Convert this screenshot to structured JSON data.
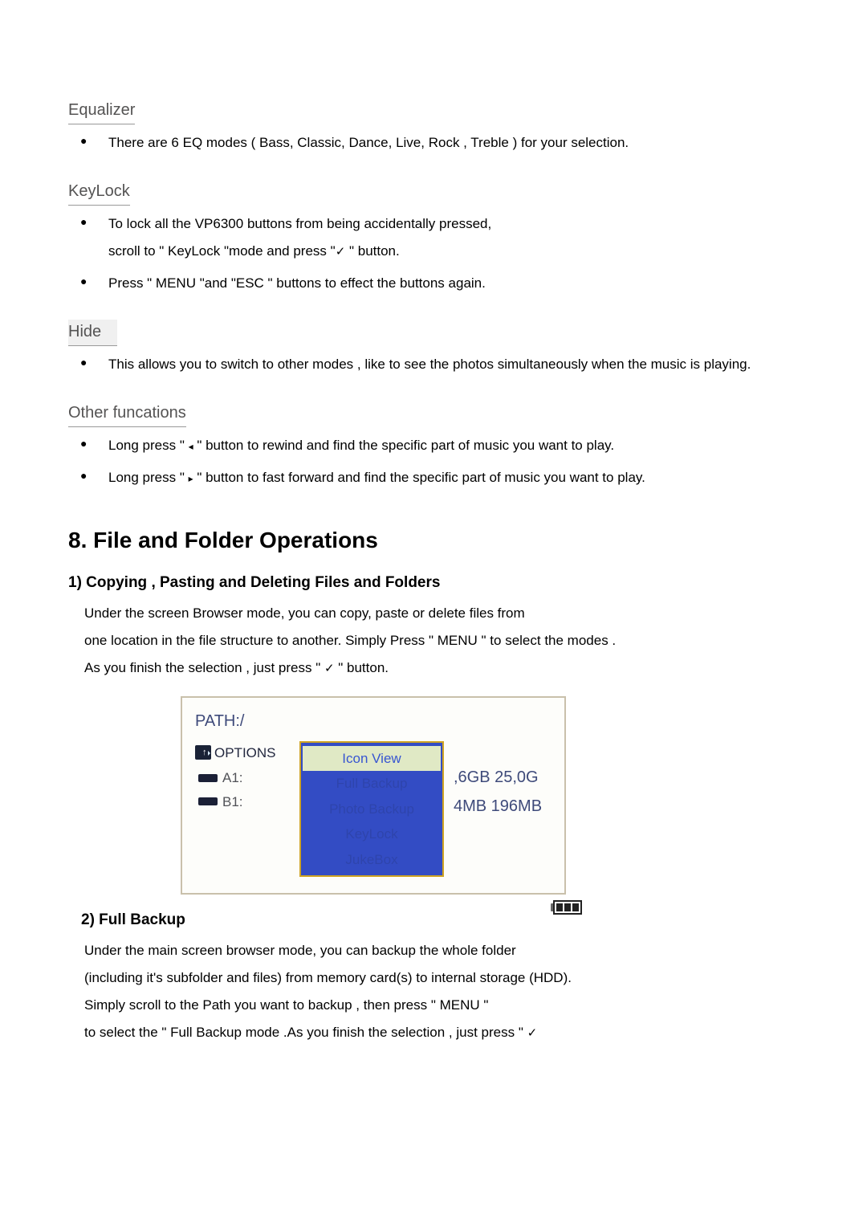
{
  "equalizer": {
    "heading": "Equalizer",
    "item1": "There are 6 EQ modes ( Bass, Classic, Dance, Live, Rock , Treble ) for your selection."
  },
  "keylock": {
    "heading": "KeyLock",
    "item1_a": "To lock all the VP6300 buttons from being accidentally pressed,",
    "item1_b": "scroll to \" KeyLock \"mode and press    \"",
    "item1_c": " \" button.",
    "item2": "Press \" MENU \"and \"ESC \" buttons to effect the buttons again."
  },
  "hide": {
    "heading": "Hide",
    "item1": "This allows you to switch to other modes , like to see the photos simultaneously when the music is playing."
  },
  "other": {
    "heading": "Other funcations",
    "item1_a": "Long press \" ",
    "item1_b": "    \" button to rewind and find the specific part of music you want to play.",
    "item2_a": "Long press \"  ",
    "item2_b": "  \" button to fast forward and find the specific part of music you want to play."
  },
  "section8": {
    "heading": "8. File and Folder Operations",
    "sub1_heading": "1) Copying , Pasting and Deleting Files and Folders",
    "sub1_p1": "Under the screen Browser mode, you can copy, paste or delete files from",
    "sub1_p2": "one location in the file structure to another. Simply Press \" MENU \" to select the modes .",
    "sub1_p3a": "As you finish the selection , just press \" ",
    "sub1_p3b": "    \" button.",
    "sub2_heading": "2) Full Backup",
    "sub2_p1": "Under the main screen browser mode, you can backup the whole folder",
    "sub2_p2": "(including it's subfolder and files) from memory card(s) to internal storage (HDD).",
    "sub2_p3": "Simply scroll to the Path you want to backup , then press \" MENU \"",
    "sub2_p4": "to select the \" Full Backup mode .As you finish the selection , just press \"    "
  },
  "device": {
    "path_label": "PATH:/",
    "options_label": "OPTIONS",
    "drive_a": "A1:",
    "drive_b": "B1:",
    "menu": {
      "icon_view": "Icon View",
      "full_backup": "Full Backup",
      "photo_backup": "Photo Backup",
      "keylock": "KeyLock",
      "jukebox": "JukeBox"
    },
    "size_a": ",6GB 25,0G",
    "size_b": "4MB 196MB"
  }
}
